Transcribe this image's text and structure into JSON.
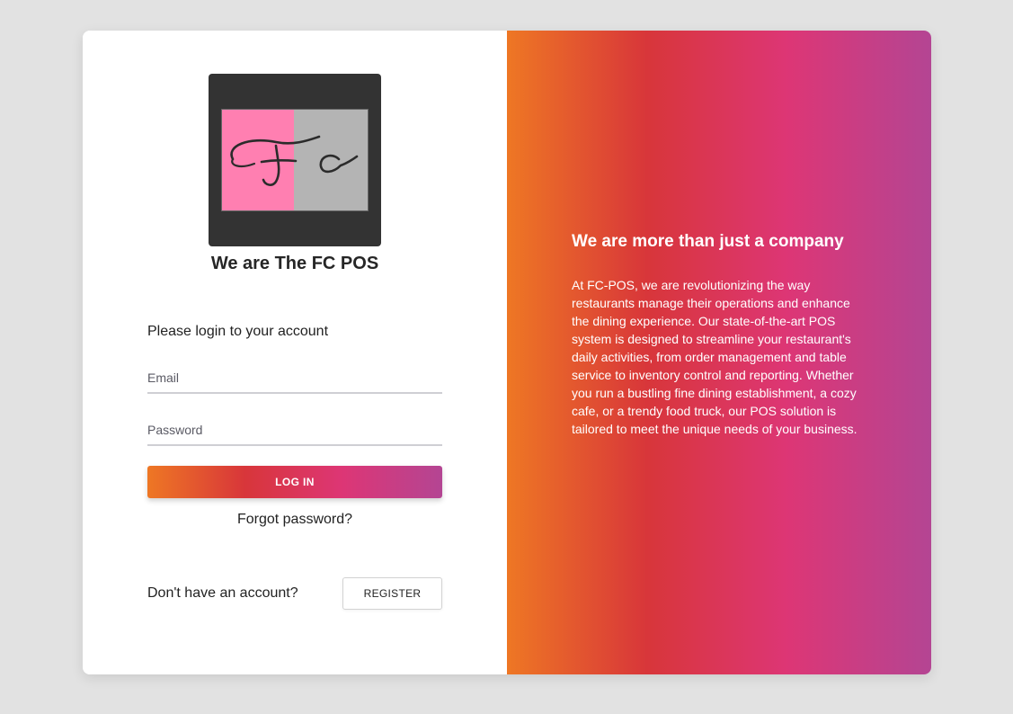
{
  "brand": {
    "logo_text": "Fc",
    "title": "We are The FC POS"
  },
  "login": {
    "prompt": "Please login to your account",
    "email_placeholder": "Email",
    "password_placeholder": "Password",
    "login_button": "LOG IN",
    "forgot_link": "Forgot password?"
  },
  "register": {
    "prompt": "Don't have an account?",
    "button": "REGISTER"
  },
  "info": {
    "heading": "We are more than just a company",
    "body": "At FC-POS, we are revolutionizing the way restaurants manage their operations and enhance the dining experience. Our state-of-the-art POS system is designed to streamline your restaurant's daily activities, from order management and table service to inventory control and reporting. Whether you run a bustling fine dining establishment, a cozy cafe, or a trendy food truck, our POS solution is tailored to meet the unique needs of your business."
  },
  "colors": {
    "gradient": [
      "#ee7724",
      "#d8363a",
      "#dd3675",
      "#b44593"
    ],
    "logo_background": "#333333",
    "logo_pink": "#ff7fb1",
    "logo_grey": "#b4b4b4",
    "page_background": "#e2e2e2"
  }
}
